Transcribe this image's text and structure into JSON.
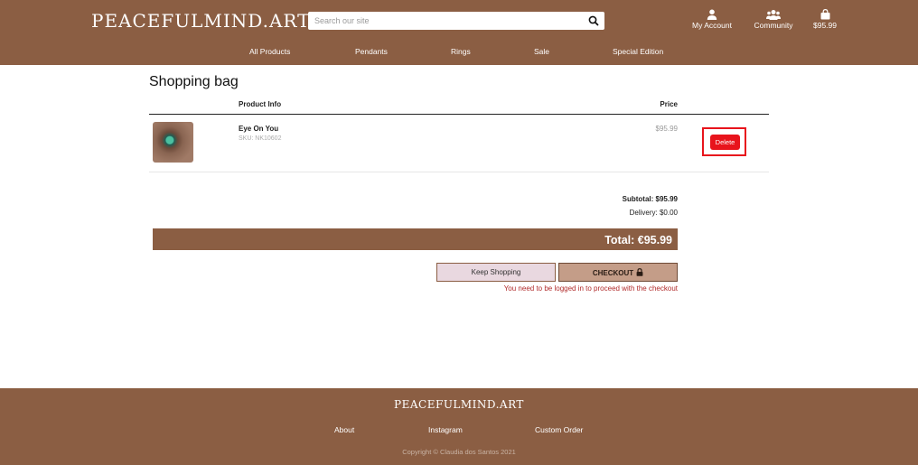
{
  "header": {
    "logo": "PEACEFULMIND.ART",
    "search_placeholder": "Search our site",
    "account_label": "My Account",
    "community_label": "Community",
    "cart_total": "$95.99"
  },
  "nav": [
    "All Products",
    "Pendants",
    "Rings",
    "Sale",
    "Special Edition"
  ],
  "bag": {
    "title": "Shopping bag",
    "columns": {
      "product_info": "Product Info",
      "price": "Price"
    },
    "items": [
      {
        "name": "Eye On You",
        "sku": "SKU: NK10602",
        "price": "$95.99",
        "delete_label": "Delete"
      }
    ],
    "subtotal": "Subtotal: $95.99",
    "delivery": "Delivery: $0.00",
    "total": "Total: €95.99",
    "keep_shopping_label": "Keep Shopping",
    "checkout_label": "CHECKOUT",
    "login_note": "You need to be logged in to proceed with the checkout"
  },
  "footer": {
    "logo": "PEACEFULMIND.ART",
    "links": [
      "About",
      "Instagram",
      "Custom Order"
    ],
    "copyright": "Copyright © Claudia dos Santos 2021"
  },
  "colors": {
    "brand_brown": "#8b5e43",
    "delete_red": "#e8141c",
    "keep_shopping_bg": "#e9d8e0",
    "checkout_bg": "#c49d88",
    "warning_text": "#b02a2a"
  },
  "icons": [
    "search-icon",
    "user-icon",
    "users-icon",
    "shopping-bag-icon",
    "lock-icon"
  ]
}
